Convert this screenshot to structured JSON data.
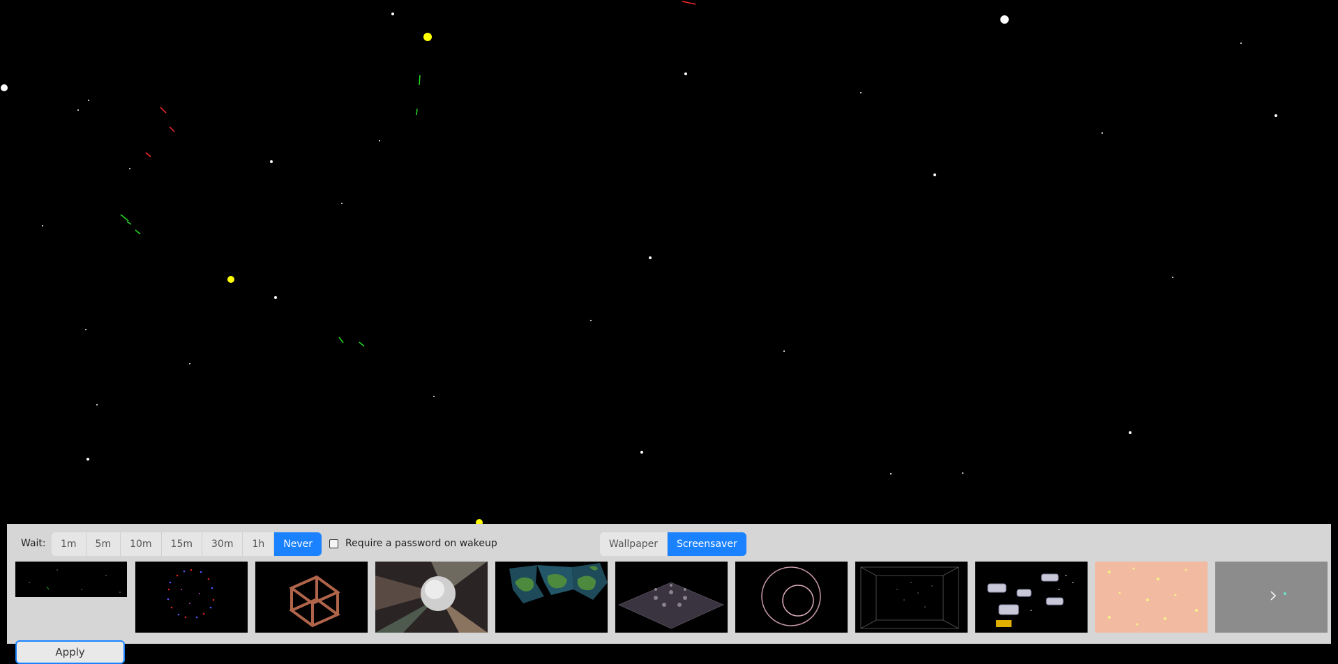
{
  "wait": {
    "label": "Wait:",
    "options": [
      "1m",
      "5m",
      "10m",
      "15m",
      "30m",
      "1h",
      "Never"
    ],
    "selected": "Never"
  },
  "password": {
    "label": "Require a password on wakeup",
    "checked": false
  },
  "mode": {
    "options": [
      "Wallpaper",
      "Screensaver"
    ],
    "selected": "Screensaver"
  },
  "apply_label": "Apply",
  "thumbnails": [
    {
      "name": "starfield"
    },
    {
      "name": "particle-ring"
    },
    {
      "name": "wire-cube"
    },
    {
      "name": "mirror-ball"
    },
    {
      "name": "globe-map"
    },
    {
      "name": "grid-plane"
    },
    {
      "name": "circles"
    },
    {
      "name": "wire-box"
    },
    {
      "name": "spaceships"
    },
    {
      "name": "pastel-dots"
    }
  ],
  "next_icon": "chevron-right-icon",
  "colors": {
    "accent": "#1a82ff",
    "panel": "#d6d6d6",
    "background": "#000000"
  }
}
